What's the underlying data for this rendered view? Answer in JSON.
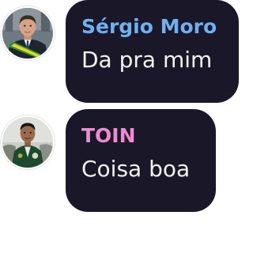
{
  "messages": [
    {
      "sender": "Sérgio Moro",
      "sender_color": "#6fb1f0",
      "text": "Da pra mim",
      "avatar_icon": "sergio-moro-avatar"
    },
    {
      "sender": "TOIN",
      "sender_color": "#f08ad0",
      "text": "Coisa boa",
      "avatar_icon": "toin-avatar"
    }
  ],
  "colors": {
    "bubble_background": "#1a1728",
    "message_text": "#f2f2f2",
    "page_background": "#ffffff"
  }
}
